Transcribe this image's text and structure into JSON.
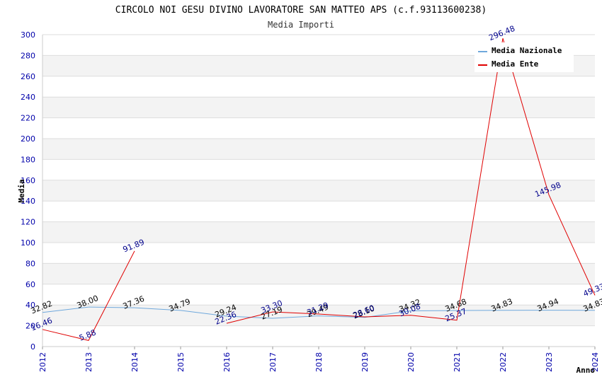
{
  "chart_data": {
    "type": "line",
    "title": "CIRCOLO NOI GESU DIVINO LAVORATORE SAN MATTEO APS (c.f.93113600238)",
    "subtitle": "Media Importi",
    "xlabel": "Anno",
    "ylabel": "Media",
    "ylim": [
      0,
      300
    ],
    "yticks": [
      0,
      20,
      40,
      60,
      80,
      100,
      120,
      140,
      160,
      180,
      200,
      220,
      240,
      260,
      280,
      300
    ],
    "x": [
      "2012",
      "2013",
      "2014",
      "2015",
      "2016",
      "2017",
      "2018",
      "2019",
      "2020",
      "2021",
      "2022",
      "2023",
      "2024"
    ],
    "grid": true,
    "legend_position": "top-right",
    "series": [
      {
        "name": "Media Nazionale",
        "color": "#6fa8dc",
        "label_color": "#000000",
        "values": [
          32.82,
          38.0,
          37.36,
          34.79,
          29.24,
          27.19,
          29.49,
          28.1,
          34.32,
          34.68,
          34.83,
          34.94,
          34.83
        ],
        "labels": [
          "32.82",
          "38.00",
          "37.36",
          "34.79",
          "29.24",
          "27.19",
          "29.49",
          "28.10",
          "34.32",
          "34.68",
          "34.83",
          "34.94",
          "34.83"
        ]
      },
      {
        "name": "Media Ente",
        "color": "#e00000",
        "label_color": "#00008b",
        "values": [
          16.46,
          5.88,
          91.89,
          null,
          22.36,
          33.3,
          31.29,
          28.6,
          30.08,
          25.37,
          296.48,
          145.98,
          49.33
        ],
        "labels": [
          "16.46",
          "5.88",
          "91.89",
          "",
          "22.36",
          "33.30",
          "31.29",
          "28.60",
          "30.08",
          "25.37",
          "296.48",
          "145.98",
          "49.33"
        ]
      }
    ]
  }
}
